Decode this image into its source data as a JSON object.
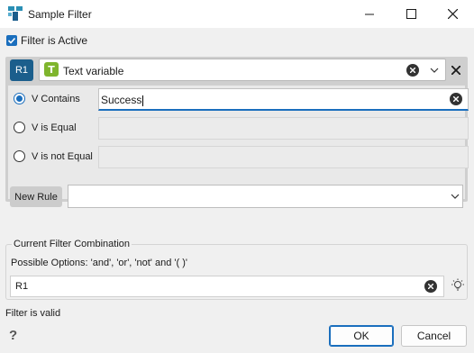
{
  "window": {
    "title": "Sample Filter"
  },
  "filter_active": {
    "label": "Filter is Active",
    "checked": true
  },
  "rule": {
    "badge": "R1",
    "variable": {
      "icon_letter": "T",
      "label": "Text variable"
    },
    "conditions": [
      {
        "label": "V Contains",
        "value": "Success",
        "selected": true
      },
      {
        "label": "V is Equal",
        "value": "",
        "selected": false
      },
      {
        "label": "V is not Equal",
        "value": "",
        "selected": false
      }
    ]
  },
  "new_rule": {
    "label": "New Rule",
    "value": ""
  },
  "combination": {
    "legend": "Current Filter Combination",
    "options": "Possible Options: 'and', 'or', 'not' and '( )'",
    "value": "R1"
  },
  "status": "Filter is valid",
  "buttons": {
    "help": "?",
    "ok": "OK",
    "cancel": "Cancel"
  },
  "colors": {
    "accent": "#1a6ebd",
    "badge": "#1b5e8c",
    "var_icon": "#7fb52d",
    "panel": "#cfcfcf"
  }
}
